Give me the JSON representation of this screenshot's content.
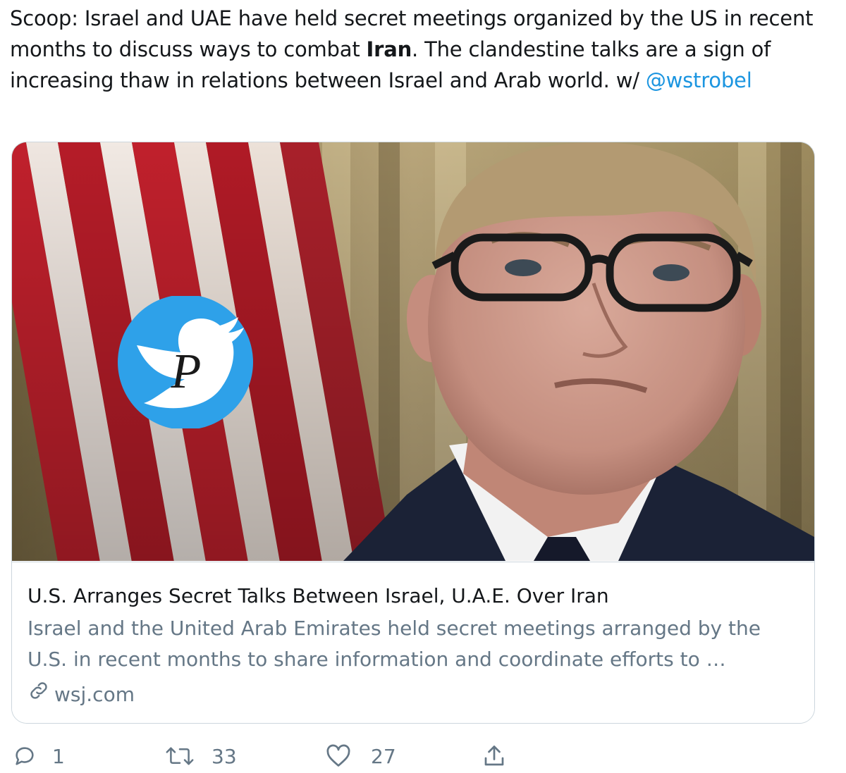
{
  "tweet": {
    "text_part1": "Scoop: Israel and UAE have held secret meetings organized by the US in recent months to discuss ways to combat ",
    "text_bold": "Iran",
    "text_part2": ". The clandestine talks are a sign of increasing thaw in relations between Israel and Arab world. w/ ",
    "mention": "@wstrobel"
  },
  "card": {
    "image_icon": "photo-of-man-with-glasses-and-us-flag",
    "watermark_icon": "twitter-bird-p-logo",
    "title": "U.S. Arranges Secret Talks Between Israel, U.A.E. Over Iran",
    "description": "Israel and the United Arab Emirates held secret meetings arranged by the U.S. in recent months to share information and coordinate efforts to …",
    "domain": "wsj.com"
  },
  "actions": {
    "reply_count": "1",
    "retweet_count": "33",
    "like_count": "27"
  },
  "colors": {
    "link": "#1b95e0",
    "muted": "#657786",
    "border": "#ccd6dd",
    "watermark_blue": "#2ea1e9"
  }
}
